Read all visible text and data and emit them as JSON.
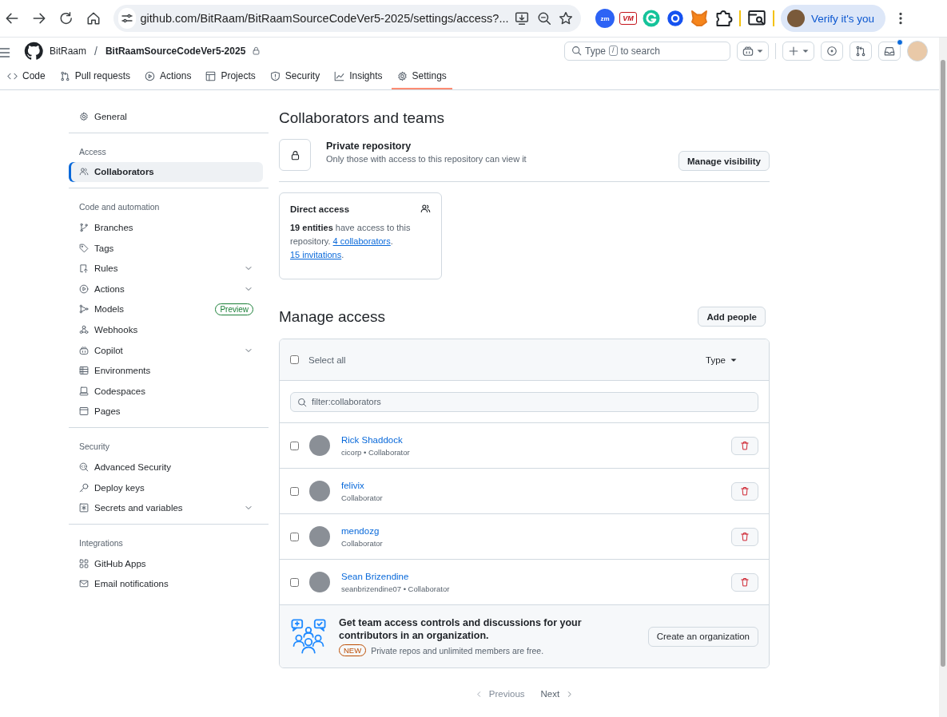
{
  "browser": {
    "url": "github.com/BitRaam/BitRaamSourceCodeVer5-2025/settings/access?...",
    "extensions": [
      {
        "kind": "zoom",
        "label": "zm"
      },
      {
        "kind": "vm",
        "label": "VM"
      },
      {
        "kind": "grammar"
      },
      {
        "kind": "ring"
      },
      {
        "kind": "fox"
      },
      {
        "kind": "puzzle"
      }
    ],
    "profile_button": "Verify it's you"
  },
  "header": {
    "owner": "BitRaam",
    "separator": "/",
    "repo": "BitRaamSourceCodeVer5-2025",
    "private": true,
    "search": {
      "prefix": "Type",
      "key": "/",
      "suffix": "to search"
    },
    "inbox_unread": true
  },
  "tabs": [
    {
      "label": "Code",
      "selected": false
    },
    {
      "label": "Pull requests",
      "selected": false
    },
    {
      "label": "Actions",
      "selected": false
    },
    {
      "label": "Projects",
      "selected": false
    },
    {
      "label": "Security",
      "selected": false
    },
    {
      "label": "Insights",
      "selected": false
    },
    {
      "label": "Settings",
      "selected": true
    }
  ],
  "sidebar": {
    "sections": [
      {
        "items": [
          {
            "label": "General",
            "selected": false,
            "expandable": false
          }
        ]
      },
      {
        "heading": "Access",
        "items": [
          {
            "label": "Collaborators",
            "selected": true,
            "expandable": false
          }
        ]
      },
      {
        "heading": "Code and automation",
        "items": [
          {
            "label": "Branches",
            "selected": false,
            "expandable": false
          },
          {
            "label": "Tags",
            "selected": false,
            "expandable": false
          },
          {
            "label": "Rules",
            "selected": false,
            "expandable": true
          },
          {
            "label": "Actions",
            "selected": false,
            "expandable": true
          },
          {
            "label": "Models",
            "selected": false,
            "expandable": false,
            "badge": "Preview"
          },
          {
            "label": "Webhooks",
            "selected": false,
            "expandable": false
          },
          {
            "label": "Copilot",
            "selected": false,
            "expandable": true
          },
          {
            "label": "Environments",
            "selected": false,
            "expandable": false
          },
          {
            "label": "Codespaces",
            "selected": false,
            "expandable": false
          },
          {
            "label": "Pages",
            "selected": false,
            "expandable": false
          }
        ]
      },
      {
        "heading": "Security",
        "items": [
          {
            "label": "Advanced Security",
            "selected": false,
            "expandable": false
          },
          {
            "label": "Deploy keys",
            "selected": false,
            "expandable": false
          },
          {
            "label": "Secrets and variables",
            "selected": false,
            "expandable": true
          }
        ]
      },
      {
        "heading": "Integrations",
        "items": [
          {
            "label": "GitHub Apps",
            "selected": false,
            "expandable": false
          },
          {
            "label": "Email notifications",
            "selected": false,
            "expandable": false
          }
        ]
      }
    ]
  },
  "page_title": "Collaborators and teams",
  "visibility": {
    "title": "Private repository",
    "description": "Only those with access to this repository can view it",
    "button": "Manage visibility"
  },
  "direct_access": {
    "title": "Direct access",
    "summary": "**19 entities** have access to this repository.",
    "links": [
      {
        "text": "4 collaborators",
        "after": "."
      },
      {
        "text": "15 invitations",
        "after": "."
      }
    ]
  },
  "manage_access": {
    "title": "Manage access",
    "add_button": "Add people",
    "select_all": {
      "label": "Select all",
      "checked": false
    },
    "type_filter": "Type",
    "filter_value": "filter:collaborators",
    "members": [
      {
        "name": "Rick Shaddock",
        "subtitle": "cicorp • Collaborator",
        "checked": false
      },
      {
        "name": "felivix",
        "subtitle": "Collaborator",
        "checked": false
      },
      {
        "name": "mendozg",
        "subtitle": "Collaborator",
        "checked": false
      },
      {
        "name": "Sean Brizendine",
        "subtitle": "seanbrizendine07 • Collaborator",
        "checked": false
      }
    ]
  },
  "promo": {
    "text": "Get team access controls and discussions for your contributors in an organization.",
    "badge": "NEW",
    "note": "Private repos and unlimited members are free.",
    "button": "Create an organization"
  },
  "pagination": [
    {
      "label": "Previous",
      "kind": "prev",
      "disabled": true
    },
    {
      "label": "Next",
      "kind": "next",
      "disabled": false
    }
  ]
}
